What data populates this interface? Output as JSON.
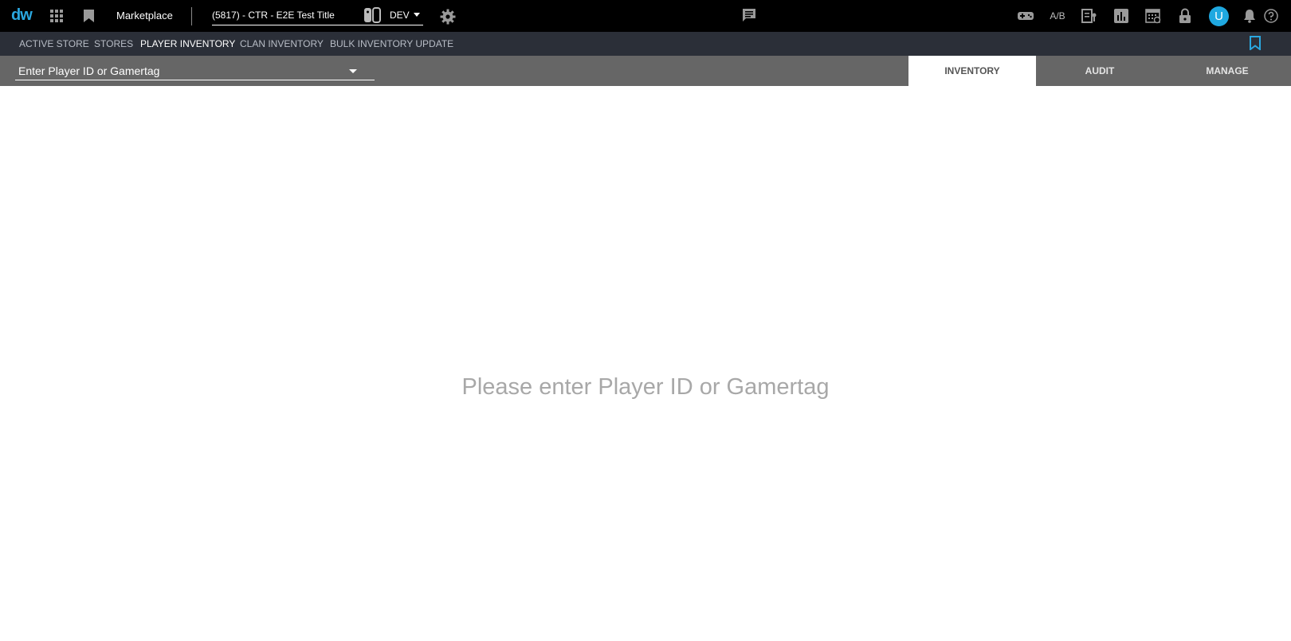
{
  "header": {
    "logo": "dw",
    "app_title": "Marketplace",
    "title_select": {
      "value": "(5817) - CTR - E2E Test Title",
      "environment": "DEV"
    },
    "avatar_initial": "U",
    "ab_label": "A/B",
    "icons": [
      "apps-grid-icon",
      "bookmark-icon",
      "platform-switch-icon",
      "settings-gear-icon",
      "chat-icon",
      "gamepad-icon",
      "ab-test-icon",
      "report-icon",
      "bar-chart-icon",
      "calendar-icon",
      "lock-icon",
      "notifications-bell-icon",
      "help-icon"
    ]
  },
  "subnav": {
    "items": [
      "ACTIVE STORE",
      "STORES",
      "PLAYER INVENTORY",
      "CLAN INVENTORY",
      "BULK INVENTORY UPDATE"
    ],
    "active": "PLAYER INVENTORY"
  },
  "toolbar": {
    "player_select_placeholder": "Enter Player ID or Gamertag",
    "tabs": [
      "INVENTORY",
      "AUDIT",
      "MANAGE"
    ],
    "active_tab": "INVENTORY"
  },
  "main": {
    "empty_message": "Please enter Player ID or Gamertag"
  },
  "colors": {
    "accent": "#2aa7df",
    "topbar": "#000000",
    "subnav": "#2b2f38",
    "toolbar": "#666666"
  }
}
